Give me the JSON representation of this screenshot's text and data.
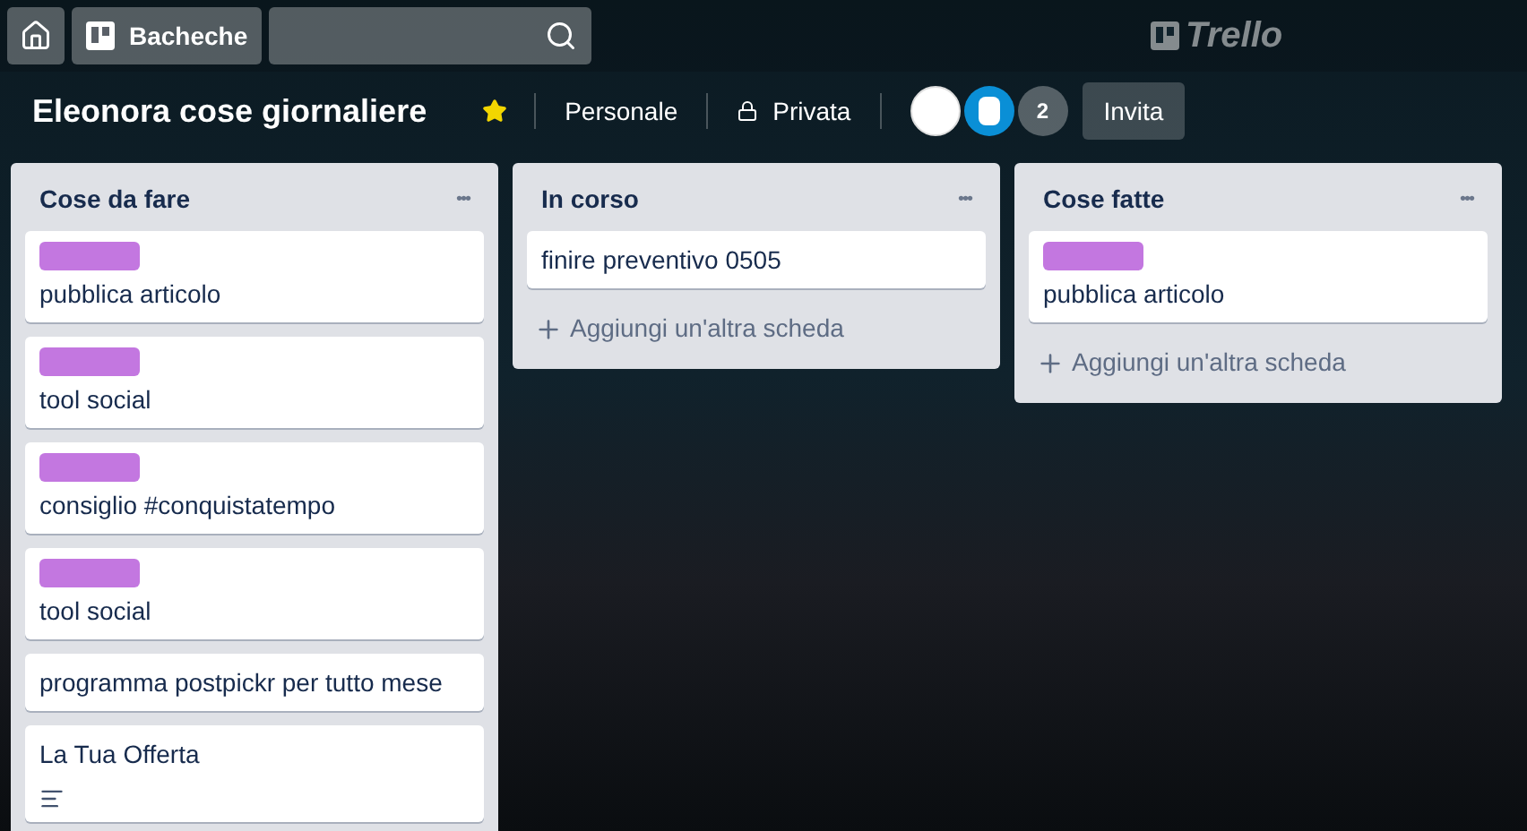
{
  "top_bar": {
    "boards_button": "Bacheche",
    "logo": "Trello"
  },
  "board_header": {
    "title": "Eleonora cose giornaliere",
    "starred": true,
    "team": "Personale",
    "visibility": "Privata",
    "member_count": "2",
    "invite_button": "Invita"
  },
  "lists": [
    {
      "title": "Cose da fare",
      "menu": "•••",
      "cards": [
        {
          "title": "pubblica articolo",
          "color": "#c377e0"
        },
        {
          "title": "tool social",
          "color": "#c377e0"
        },
        {
          "title": "consiglio #conquistatempo",
          "color": "#c377e0"
        },
        {
          "title": "tool social",
          "color": "#c377e0"
        },
        {
          "title": "programma postpickr per tutto mese"
        },
        {
          "title": "La Tua Offerta",
          "has_description": true
        }
      ]
    },
    {
      "title": "In corso",
      "menu": "•••",
      "cards": [
        {
          "title": "finire preventivo 0505"
        }
      ],
      "add_card": "Aggiungi un'altra scheda"
    },
    {
      "title": "Cose fatte",
      "menu": "•••",
      "cards": [
        {
          "title": "pubblica articolo",
          "color": "#c377e0"
        }
      ],
      "add_card": "Aggiungi un'altra scheda"
    }
  ]
}
